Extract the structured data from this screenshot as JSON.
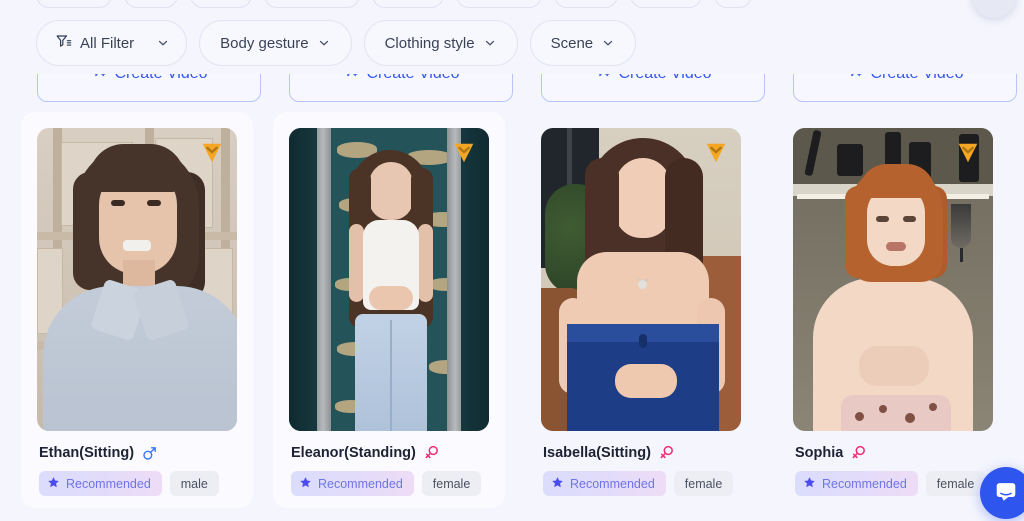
{
  "background_color": "#f4f5fd",
  "accent_color": "#3355f5",
  "filters": {
    "primary": {
      "label": "All Filter",
      "icon": "funnel-icon",
      "caret": "chevron-down-icon"
    },
    "items": [
      {
        "label": "Body gesture",
        "caret": "chevron-down-icon"
      },
      {
        "label": "Clothing style",
        "caret": "chevron-down-icon"
      },
      {
        "label": "Scene",
        "caret": "chevron-down-icon"
      }
    ]
  },
  "create_video": {
    "label": "Create Video",
    "icon": "filter-plus-icon",
    "count": 4,
    "color": "#3355f5"
  },
  "cards": [
    {
      "name": "Ethan(Sitting)",
      "gender": "male",
      "gender_icon": "male-symbol-icon",
      "gender_color": "#3b76f6",
      "badge_icon": "gem-badge-icon",
      "badge_color": "#f5a623",
      "tags": [
        {
          "label": "Recommended",
          "style": "recommended",
          "icon": "star-icon"
        },
        {
          "label": "male",
          "style": "plain"
        }
      ]
    },
    {
      "name": "Eleanor(Standing)",
      "gender": "female",
      "gender_icon": "female-symbol-icon",
      "gender_color": "#f02a78",
      "badge_icon": "gem-badge-icon",
      "badge_color": "#f5a623",
      "tags": [
        {
          "label": "Recommended",
          "style": "recommended",
          "icon": "star-icon"
        },
        {
          "label": "female",
          "style": "plain"
        }
      ]
    },
    {
      "name": "Isabella(Sitting)",
      "gender": "female",
      "gender_icon": "female-symbol-icon",
      "gender_color": "#f02a78",
      "badge_icon": "gem-badge-icon",
      "badge_color": "#f5a623",
      "tags": [
        {
          "label": "Recommended",
          "style": "recommended",
          "icon": "star-icon"
        },
        {
          "label": "female",
          "style": "plain"
        }
      ]
    },
    {
      "name": "Sophia",
      "gender": "female",
      "gender_icon": "female-symbol-icon",
      "gender_color": "#f02a78",
      "badge_icon": "gem-badge-icon",
      "badge_color": "#f5a623",
      "tags": [
        {
          "label": "Recommended",
          "style": "recommended",
          "icon": "star-icon"
        },
        {
          "label": "female",
          "style": "plain"
        }
      ]
    }
  ],
  "chat_fab": {
    "icon": "chat-bubble-icon",
    "color": "#2f55ef"
  }
}
